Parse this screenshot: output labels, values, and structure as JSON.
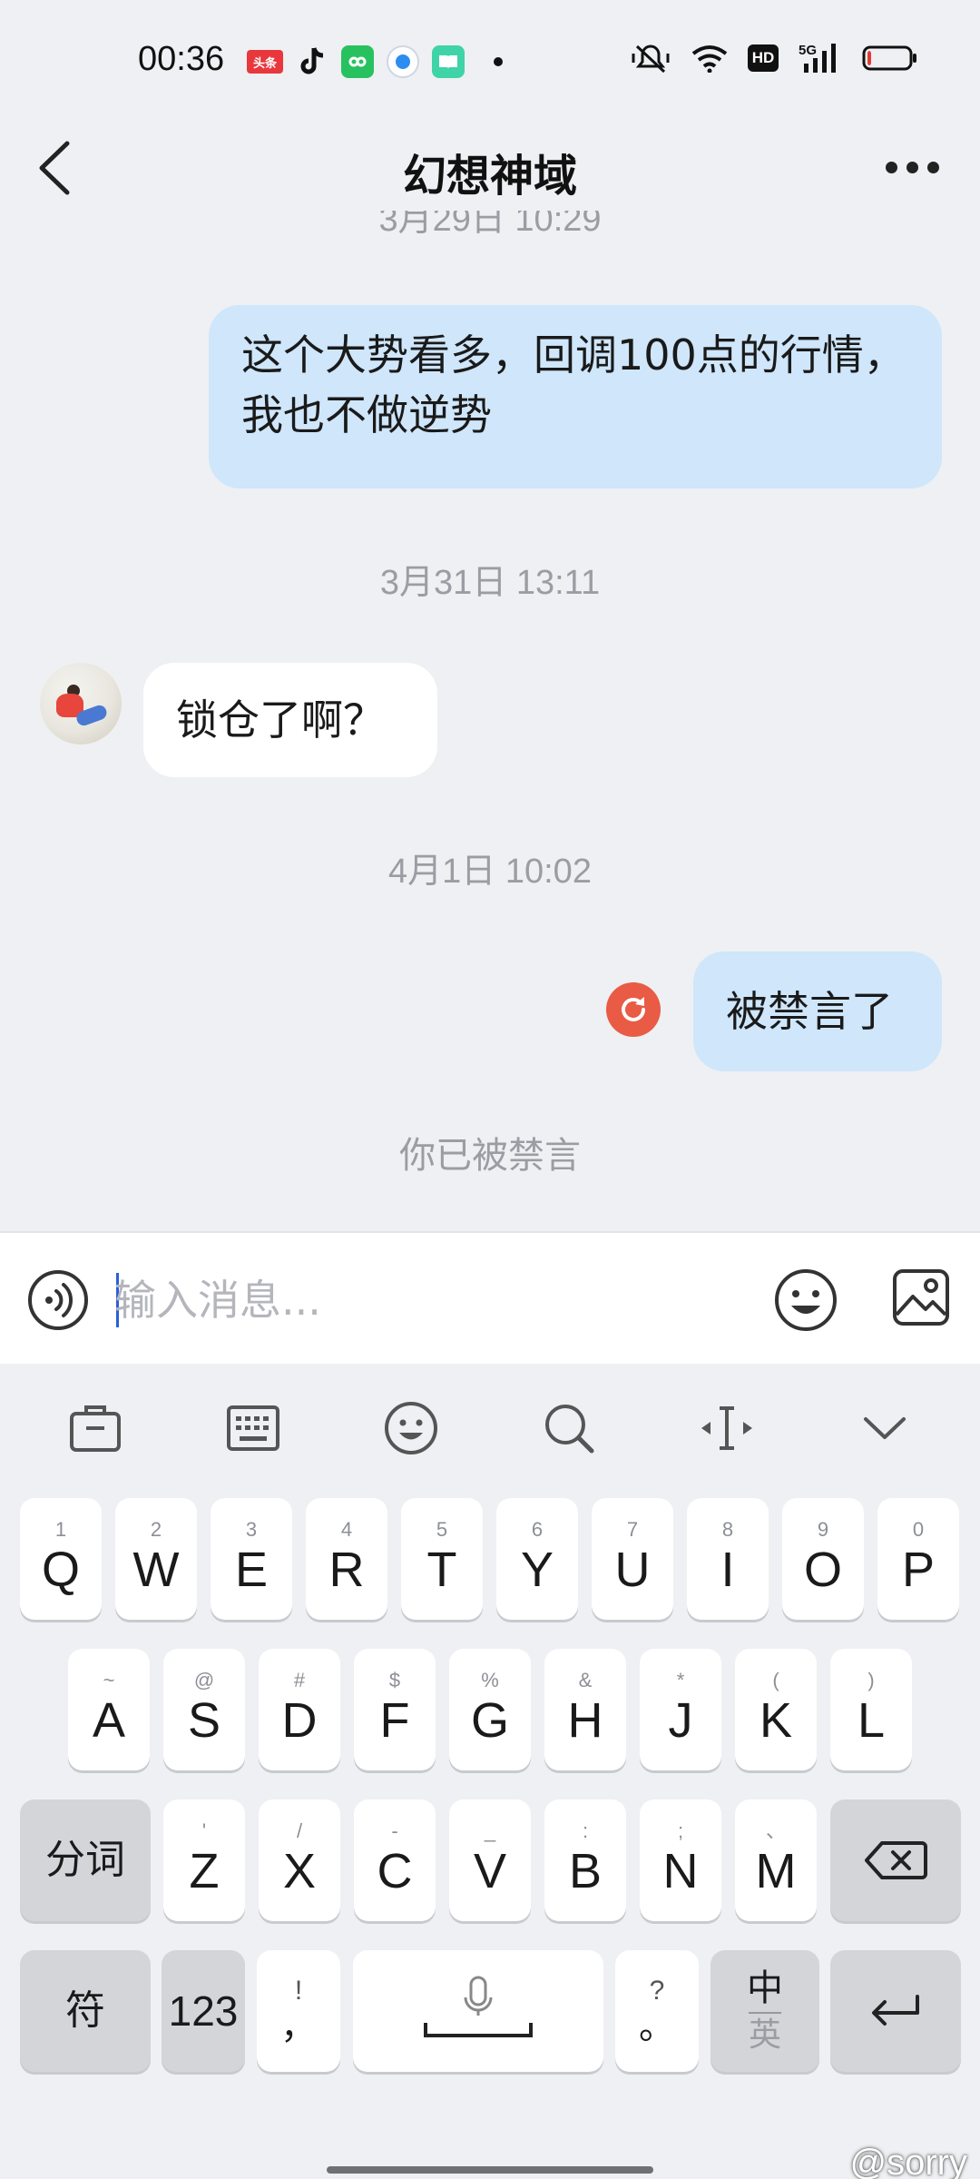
{
  "status_bar": {
    "time": "00:36",
    "apps": [
      "头条",
      "douyin-icon",
      "wechat-mini-icon",
      "browser-icon",
      "reader-icon"
    ],
    "hd_badge": "HD",
    "network": "5G",
    "battery_level": 0.1,
    "battery_color": "#e53935"
  },
  "header": {
    "title": "幻想神域"
  },
  "messages": {
    "clipped_timestamp": "3月29日 10:29",
    "outgoing_1": "这个大势看多，回调100点的行情，我也不做逆势",
    "timestamp_2": "3月31日 13:11",
    "incoming_1": "锁仓了啊？",
    "timestamp_3": "4月1日 10:02",
    "outgoing_2": "被禁言了",
    "muted_notice": "你已被禁言"
  },
  "input_bar": {
    "placeholder": "输入消息...",
    "value": ""
  },
  "keyboard": {
    "toolbar": [
      "clipboard-icon",
      "keyboard-icon",
      "emoji-icon",
      "search-icon",
      "cursor-icon",
      "collapse-icon"
    ],
    "row1": [
      {
        "hint": "1",
        "key": "Q"
      },
      {
        "hint": "2",
        "key": "W"
      },
      {
        "hint": "3",
        "key": "E"
      },
      {
        "hint": "4",
        "key": "R"
      },
      {
        "hint": "5",
        "key": "T"
      },
      {
        "hint": "6",
        "key": "Y"
      },
      {
        "hint": "7",
        "key": "U"
      },
      {
        "hint": "8",
        "key": "I"
      },
      {
        "hint": "9",
        "key": "O"
      },
      {
        "hint": "0",
        "key": "P"
      }
    ],
    "row2": [
      {
        "hint": "~",
        "key": "A"
      },
      {
        "hint": "@",
        "key": "S"
      },
      {
        "hint": "#",
        "key": "D"
      },
      {
        "hint": "$",
        "key": "F"
      },
      {
        "hint": "%",
        "key": "G"
      },
      {
        "hint": "&",
        "key": "H"
      },
      {
        "hint": "*",
        "key": "J"
      },
      {
        "hint": "(",
        "key": "K"
      },
      {
        "hint": ")",
        "key": "L"
      }
    ],
    "row3": [
      {
        "hint": "'",
        "key": "Z"
      },
      {
        "hint": "/",
        "key": "X"
      },
      {
        "hint": "-",
        "key": "C"
      },
      {
        "hint": "_",
        "key": "V"
      },
      {
        "hint": ":",
        "key": "B"
      },
      {
        "hint": ";",
        "key": "N"
      },
      {
        "hint": "、",
        "key": "M"
      }
    ],
    "fenci": "分词",
    "symbol": "符",
    "numbers": "123",
    "comma_hint": "!",
    "comma": "，",
    "period_hint": "?",
    "period": "。",
    "lang_top": "中",
    "lang_bottom": "英"
  },
  "watermark": "@sorry"
}
